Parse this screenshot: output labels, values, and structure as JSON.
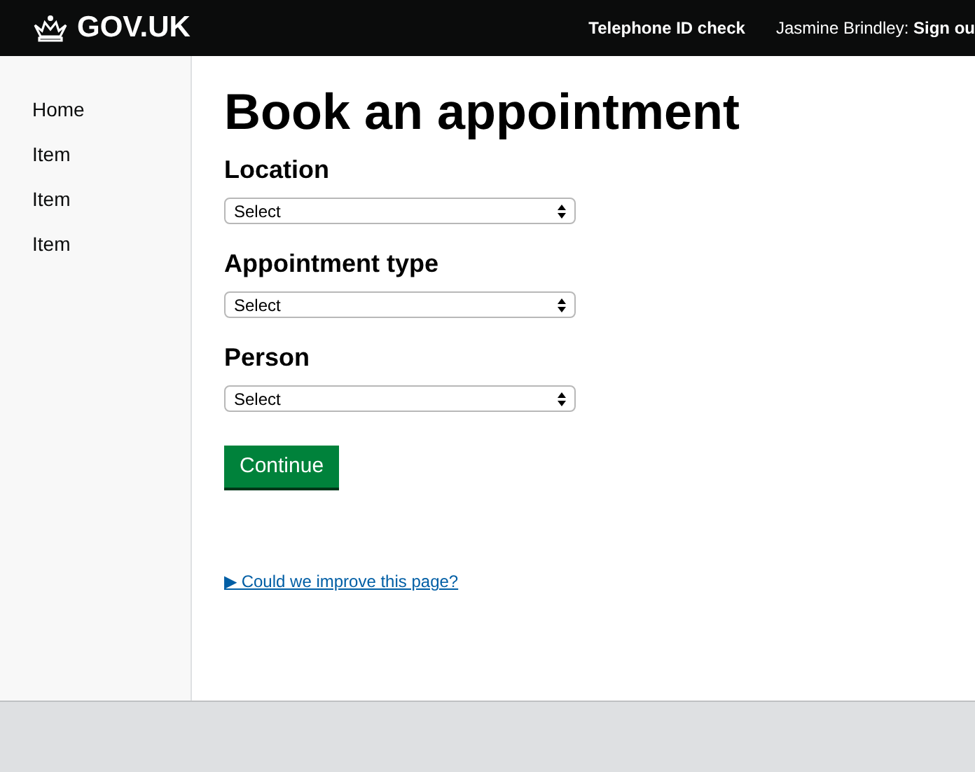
{
  "header": {
    "logo": "GOV.UK",
    "service": "Telephone ID check",
    "user": "Jasmine Brindley: **Sign ou**"
  },
  "sidebar": {
    "items": [
      "Home",
      "Item",
      "Item",
      "Item"
    ]
  },
  "page": {
    "title": "Book an appointment",
    "fields": [
      {
        "label": "Location",
        "value": "Select"
      },
      {
        "label": "Appointment type",
        "value": "Select"
      },
      {
        "label": "Person",
        "value": "Select"
      }
    ],
    "button": "Continue",
    "feedback_link": "▶ Could we improve this page?"
  }
}
